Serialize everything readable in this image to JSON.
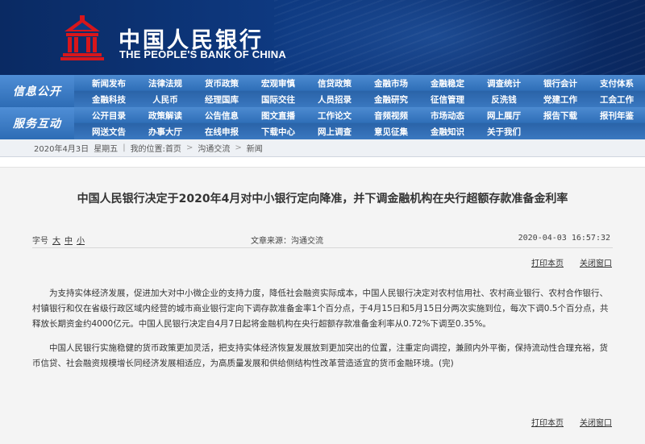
{
  "header": {
    "name_cn": "中国人民银行",
    "name_en": "THE PEOPLE'S BANK OF CHINA",
    "colors": {
      "banner": "#0e3a82",
      "emblem": "#d8161b"
    }
  },
  "nav": {
    "sections": [
      {
        "title": "信息公开",
        "rows": [
          [
            "新闻发布",
            "法律法规",
            "货币政策",
            "宏观审慎",
            "信贷政策",
            "金融市场",
            "金融稳定",
            "调查统计",
            "银行会计",
            "支付体系"
          ],
          [
            "金融科技",
            "人民币",
            "经理国库",
            "国际交往",
            "人员招录",
            "金融研究",
            "征信管理",
            "反洗钱",
            "党建工作",
            "工会工作"
          ]
        ]
      },
      {
        "title": "服务互动",
        "rows": [
          [
            "公开目录",
            "政策解读",
            "公告信息",
            "图文直播",
            "工作论文",
            "音频视频",
            "市场动态",
            "网上展厅",
            "报告下载",
            "报刊年鉴"
          ],
          [
            "网送文告",
            "办事大厅",
            "在线申报",
            "下载中心",
            "网上调查",
            "意见征集",
            "金融知识",
            "关于我们"
          ]
        ]
      }
    ]
  },
  "breadcrumb": {
    "date": "2020年4月3日",
    "weekday": "星期五",
    "location_label": "我的位置:",
    "items": [
      "首页",
      "沟通交流",
      "新闻"
    ],
    "separator": ">"
  },
  "article": {
    "title": "中国人民银行决定于2020年4月对中小银行定向降准，并下调金融机构在央行超额存款准备金利率",
    "font_size_label": "字号",
    "font_size_options": [
      "大",
      "中",
      "小"
    ],
    "source": "文章来源：沟通交流",
    "datetime": "2020-04-03 16:57:32",
    "actions": {
      "print": "打印本页",
      "close": "关闭窗口"
    },
    "paragraphs": [
      "为支持实体经济发展，促进加大对中小微企业的支持力度，降低社会融资实际成本，中国人民银行决定对农村信用社、农村商业银行、农村合作银行、村镇银行和仅在省级行政区域内经营的城市商业银行定向下调存款准备金率1个百分点，于4月15日和5月15日分两次实施到位，每次下调0.5个百分点，共释放长期资金约4000亿元。中国人民银行决定自4月7日起将金融机构在央行超额存款准备金利率从0.72%下调至0.35%。",
      "中国人民银行实施稳健的货币政策更加灵活，把支持实体经济恢复发展放到更加突出的位置，注重定向调控，兼顾内外平衡，保持流动性合理充裕，货币信贷、社会融资规模增长同经济发展相适应，为高质量发展和供给侧结构性改革营造适宜的货币金融环境。(完)"
    ]
  }
}
